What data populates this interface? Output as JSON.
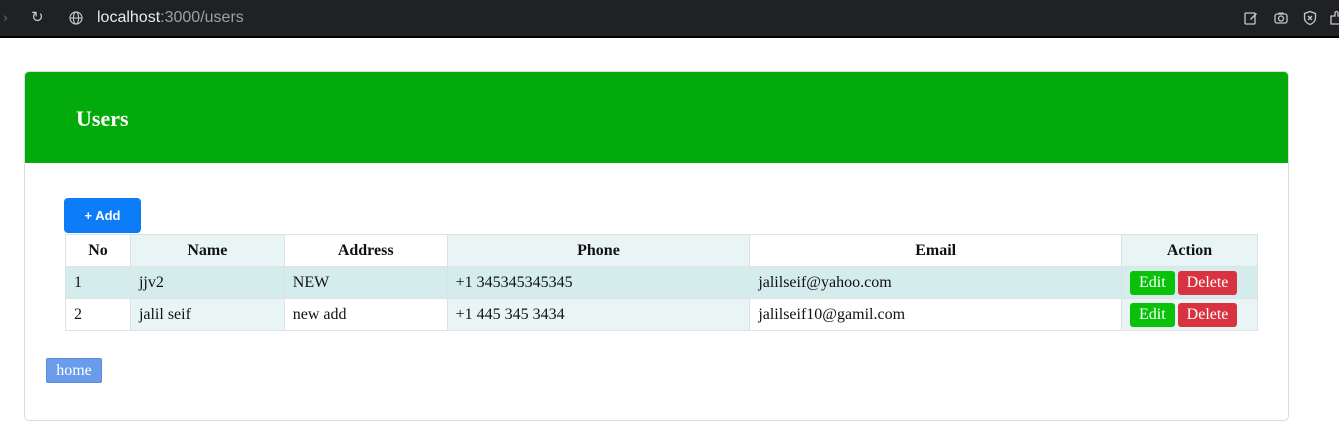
{
  "browser": {
    "url_host": "localhost",
    "url_path": ":3000/users"
  },
  "page": {
    "title": "Users",
    "add_label": "+ Add",
    "home_label": "home",
    "accent_green": "#02aa0b",
    "primary_blue": "#0d7df7"
  },
  "table": {
    "headers": [
      "No",
      "Name",
      "Address",
      "Phone",
      "Email",
      "Action"
    ],
    "rows": [
      {
        "no": "1",
        "name": "jjv2",
        "address": "NEW",
        "phone": "+1 345345345345",
        "email": "jalilseif@yahoo.com",
        "edit": "Edit",
        "delete": "Delete"
      },
      {
        "no": "2",
        "name": "jalil seif",
        "address": "new add",
        "phone": "+1 445 345 3434",
        "email": "jalilseif10@gamil.com",
        "edit": "Edit",
        "delete": "Delete"
      }
    ]
  }
}
